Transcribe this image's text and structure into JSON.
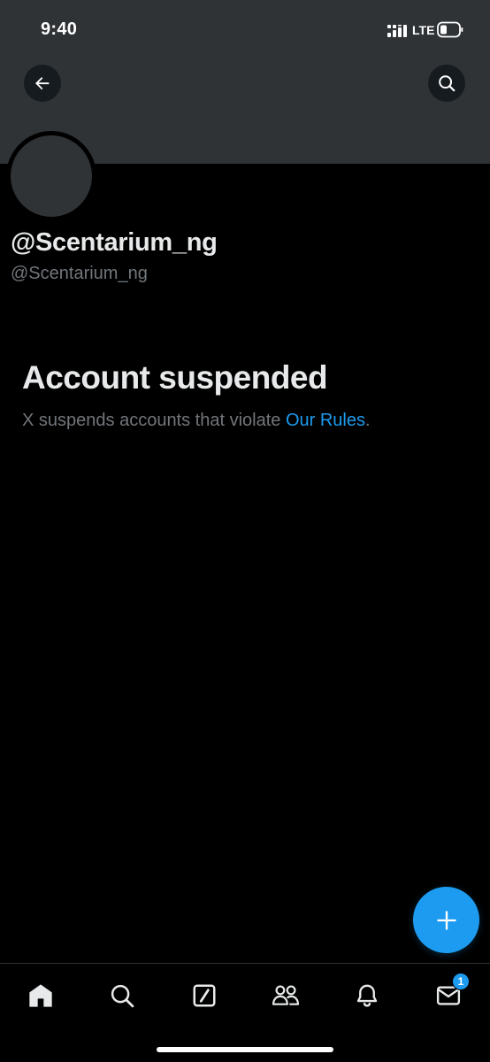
{
  "status_bar": {
    "time": "9:40",
    "network": "LTE",
    "signal_icon": "cellular-signal-icon",
    "battery_icon": "battery-low-icon"
  },
  "header": {
    "back_icon": "arrow-left-icon",
    "search_icon": "search-icon",
    "banner_color": "#2f3336"
  },
  "profile": {
    "display_name": "@Scentarium_ng",
    "handle": "@Scentarium_ng"
  },
  "suspension": {
    "title": "Account suspended",
    "message": "X suspends accounts that violate ",
    "link_text": "Our Rules",
    "trailing": "."
  },
  "fab": {
    "icon": "plus-icon"
  },
  "bottom_nav": {
    "items": [
      {
        "name": "home",
        "icon": "home-icon",
        "active": true
      },
      {
        "name": "search",
        "icon": "search-icon"
      },
      {
        "name": "grok",
        "icon": "compose-slash-icon"
      },
      {
        "name": "communities",
        "icon": "communities-icon"
      },
      {
        "name": "notifications",
        "icon": "bell-icon"
      },
      {
        "name": "messages",
        "icon": "envelope-icon",
        "badge": "1"
      }
    ]
  },
  "colors": {
    "accent": "#1d9bf0",
    "background": "#000000",
    "text_primary": "#e7e9ea",
    "text_secondary": "#71767b"
  }
}
